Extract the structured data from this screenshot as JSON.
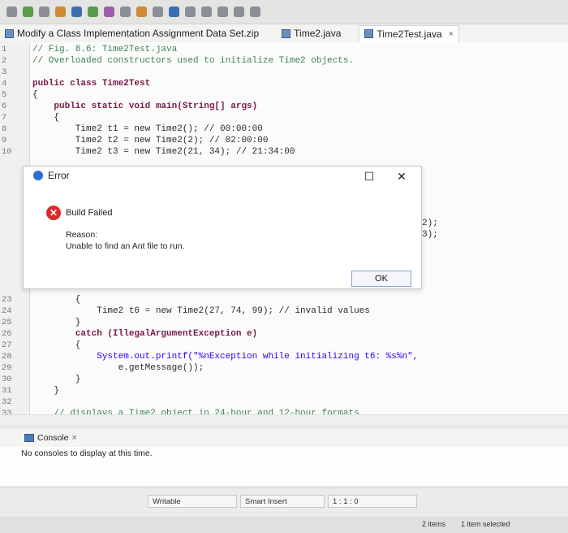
{
  "tabs": [
    {
      "label": "Modify a Class Implementation Assignment Data Set.zip"
    },
    {
      "label": "Time2.java"
    },
    {
      "label": "Time2Test.java",
      "close": "×"
    }
  ],
  "code_lines": [
    {
      "n": "1",
      "text": "// Fig. 8.6: Time2Test.java",
      "kind": "cm"
    },
    {
      "n": "2",
      "text": "// Overloaded constructors used to initialize Time2 objects.",
      "kind": "cm"
    },
    {
      "n": "3",
      "text": "",
      "kind": "plain"
    },
    {
      "n": "4",
      "text": "public class Time2Test",
      "kind": "kw"
    },
    {
      "n": "5",
      "text": "{",
      "kind": "plain"
    },
    {
      "n": "6",
      "text": "    public static void main(String[] args)",
      "kind": "kw"
    },
    {
      "n": "7",
      "text": "    {",
      "kind": "plain"
    },
    {
      "n": "8",
      "text": "        Time2 t1 = new Time2(); // 00:00:00",
      "kind": "plain"
    },
    {
      "n": "9",
      "text": "        Time2 t2 = new Time2(2); // 02:00:00",
      "kind": "plain"
    },
    {
      "n": "10",
      "text": "        Time2 t3 = new Time2(21, 34); // 21:34:00",
      "kind": "plain"
    }
  ],
  "code_lines_after": [
    {
      "n": "23",
      "text": "        {",
      "kind": "plain"
    },
    {
      "n": "24",
      "text": "            Time2 t6 = new Time2(27, 74, 99); // invalid values",
      "kind": "plain"
    },
    {
      "n": "25",
      "text": "        }",
      "kind": "plain"
    },
    {
      "n": "26",
      "text": "        catch (IllegalArgumentException e)",
      "kind": "kw"
    },
    {
      "n": "27",
      "text": "        {",
      "kind": "plain"
    },
    {
      "n": "28",
      "text": "            System.out.printf(\"%nException while initializing t6: %s%n\",",
      "kind": "str"
    },
    {
      "n": "29",
      "text": "                e.getMessage());",
      "kind": "plain"
    },
    {
      "n": "30",
      "text": "        }",
      "kind": "plain"
    },
    {
      "n": "31",
      "text": "    }",
      "kind": "plain"
    },
    {
      "n": "32",
      "text": "",
      "kind": "plain"
    },
    {
      "n": "33",
      "text": "    // displays a Time2 object in 24-hour and 12-hour formats",
      "kind": "cm"
    }
  ],
  "partial_right": [
    "2);",
    "3);"
  ],
  "dialog": {
    "title": "Error",
    "heading": "Build Failed",
    "reason_label": "Reason:",
    "reason_text": "Unable to find an Ant file to run.",
    "ok": "OK"
  },
  "console": {
    "tab_label": "Console",
    "tab_close": "×",
    "body": "No consoles to display at this time."
  },
  "status": {
    "writable": "Writable",
    "insert_mode": "Smart Insert",
    "position": "1 : 1 : 0"
  },
  "footer": {
    "items": "2 items",
    "selected": "1 item selected"
  }
}
